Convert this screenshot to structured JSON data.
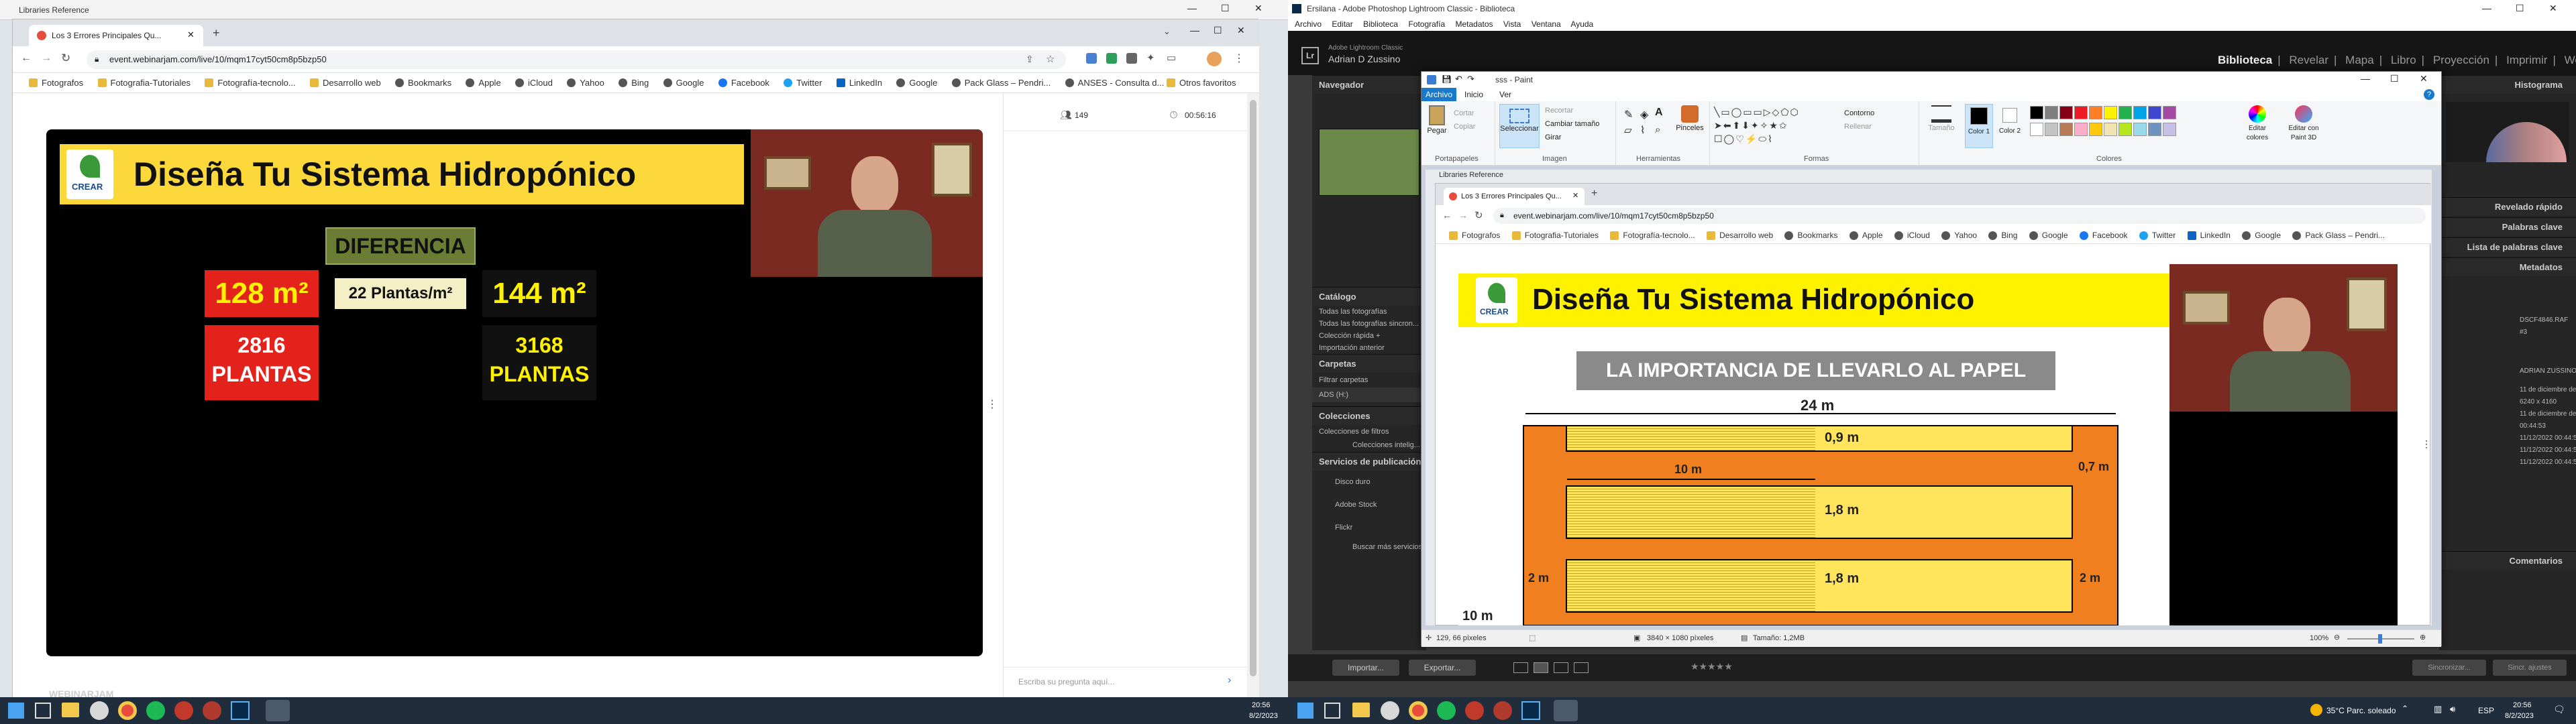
{
  "left_window": {
    "outer_title": "Libraries Reference",
    "tab_title": "Los 3 Errores Principales Qu...",
    "url": "event.webinarjam.com/live/10/mqm17cyt50cm8p5bzp50",
    "bookmarks": [
      "Fotografos",
      "Fotografia-Tutoriales",
      "Fotografía-tecnolo...",
      "Desarrollo web",
      "Bookmarks",
      "Apple",
      "iCloud",
      "Yahoo",
      "Bing",
      "Google",
      "Facebook",
      "Twitter",
      "LinkedIn",
      "Google",
      "Pack Glass – Pendri...",
      "ANSES - Consulta d..."
    ],
    "other_bookmarks": "Otros favoritos",
    "attendees": "149",
    "timer": "00:56:16",
    "question_placeholder": "Escriba su pregunta aquí...",
    "logo": "WEBINARJAM"
  },
  "slide1": {
    "title": "Diseña Tu Sistema Hidropónico",
    "logo_text": "CREAR",
    "diferencia": "DIFERENCIA",
    "area_left": "128 m²",
    "area_right": "144 m²",
    "plantas_diff": "22 Plantas/m²",
    "plants_left": "2816",
    "plants_right": "3168",
    "plantas_word": "PLANTAS"
  },
  "lightroom": {
    "title_line1": "Adobe Lightroom Classic",
    "title_line2": "Adrian D Zussino",
    "window_title": "Ersilana - Adobe Photoshop Lightroom Classic - Biblioteca",
    "menu": [
      "Archivo",
      "Editar",
      "Biblioteca",
      "Fotografía",
      "Metadatos",
      "Vista",
      "Ventana",
      "Ayuda"
    ],
    "modules": [
      "Biblioteca",
      "Revelar",
      "Mapa",
      "Libro",
      "Proyección",
      "Imprimir",
      "Web"
    ],
    "navigator": "Navegador",
    "catalog": "Catálogo",
    "catalog_items": [
      "Todas las fotografías",
      "Todas las fotografías sincron...",
      "Colección rápida +",
      "Importación anterior"
    ],
    "folders": "Carpetas",
    "folder_items": [
      "Filtrar carpetas",
      "ADS (H:)"
    ],
    "collections": "Colecciones",
    "collection_items": [
      "Colecciones de filtros",
      "Colecciones intelig..."
    ],
    "publish": "Servicios de publicación",
    "publish_items": [
      "Disco duro",
      "Adobe Stock",
      "Flickr",
      "Buscar más servicios"
    ],
    "import_btn": "Importar...",
    "export_btn": "Exportar...",
    "right_panels": [
      "Histograma",
      "Revelado rápido",
      "Palabras clave",
      "Lista de palabras clave",
      "Metadatos",
      "Comentarios"
    ],
    "meta_values": [
      "DSCF4846.RAF",
      "#3",
      "ADRIAN ZUSSINO",
      "11 de diciembre de 2...",
      "6240 x 4160",
      "11 de diciembre de 2022",
      "00:44:53",
      "11/12/2022 00:44:53",
      "11/12/2022 00:44:53",
      "11/12/2022 00:44:53"
    ],
    "sync_meta": "Sincronizar...",
    "sync_settings": "Sincr. ajustes"
  },
  "paint": {
    "title": "sss - Paint",
    "tabs": [
      "Archivo",
      "Inicio",
      "Ver"
    ],
    "clipboard": [
      "Pegar",
      "Cortar",
      "Copiar"
    ],
    "image_tools": [
      "Seleccionar",
      "Recortar",
      "Cambiar tamaño",
      "Girar"
    ],
    "groups": [
      "Portapapeles",
      "Imagen",
      "Herramientas",
      "Formas",
      "Colores"
    ],
    "shape_opts": [
      "Contorno",
      "Rellenar"
    ],
    "brushes": "Pinceles",
    "size": "Tamaño",
    "color1": "Color 1",
    "color2": "Color 2",
    "edit_colors": "Editar colores",
    "paint3d": "Editar con Paint 3D",
    "status_pos": "129, 66 píxeles",
    "status_dims": "3840 × 1080 píxeles",
    "status_size": "Tamaño: 1,2MB",
    "zoom": "100%",
    "palette": [
      "#000000",
      "#7f7f7f",
      "#880015",
      "#ed1c24",
      "#ff7f27",
      "#fff200",
      "#22b14c",
      "#00a2e8",
      "#3f48cc",
      "#a349a4",
      "#ffffff",
      "#c3c3c3",
      "#b97a57",
      "#ffaec9",
      "#ffc90e",
      "#efe4b0",
      "#b5e61d",
      "#99d9ea",
      "#7092be",
      "#c8bfe7"
    ]
  },
  "inner_browser": {
    "outer_title": "Libraries Reference",
    "tab_title": "Los 3 Errores Principales Qu...",
    "url": "event.webinarjam.com/live/10/mqm17cyt50cm8p5bzp50",
    "bookmarks": [
      "Fotografos",
      "Fotografia-Tutoriales",
      "Fotografía-tecnolo...",
      "Desarrollo web",
      "Bookmarks",
      "Apple",
      "iCloud",
      "Yahoo",
      "Bing",
      "Google",
      "Facebook",
      "Twitter",
      "LinkedIn",
      "Google",
      "Pack Glass – Pendri..."
    ]
  },
  "slide2": {
    "title": "Diseña Tu Sistema Hidropónico",
    "logo_text": "CREAR",
    "subtitle": "LA IMPORTANCIA DE LLEVARLO AL PAPEL",
    "dim_24": "24 m",
    "dim_09": "0,9 m",
    "dim_10": "10 m",
    "dim_07": "0,7 m",
    "dim_18a": "1,8 m",
    "dim_18b": "1,8 m",
    "dim_2a": "2 m",
    "dim_2b": "2 m",
    "dim_10b": "10 m"
  },
  "taskbar": {
    "left_time": "20:56",
    "left_date": "8/2/2023",
    "weather": "35°C  Parc. soleado",
    "lang": "ESP",
    "right_time": "20:56",
    "right_date": "8/2/2023"
  }
}
